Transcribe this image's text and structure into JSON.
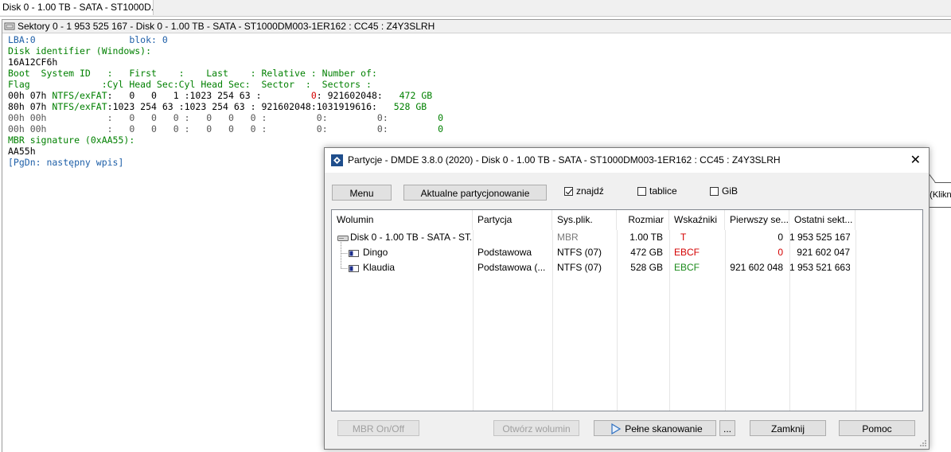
{
  "tab": {
    "label": "Disk 0 - 1.00 TB - SATA - ST1000D..."
  },
  "subwindow": {
    "title": "Sektory 0 - 1 953 525 167 - Disk 0 - 1.00 TB - SATA - ST1000DM003-1ER162 : CC45 : Z4Y3SLRH"
  },
  "hex": {
    "lba_line": "LBA:0                 blok: 0",
    "disk_id_label": "Disk identifier (Windows):",
    "disk_id_value": "16A12CF6h",
    "header1": "Boot  System ID   :   First    :    Last    : Relative : Number of:",
    "header2": "Flag             :Cyl Head Sec:Cyl Head Sec:  Sector  :  Sectors :",
    "rows": [
      {
        "a": "00h 07h ",
        "b": "NTFS/exFAT",
        "c": ":   0   0   1 :1023 254 63 :",
        "d": "         0",
        "e": ": 921602048:",
        "f": "   472 GB"
      },
      {
        "a": "80h 07h ",
        "b": "NTFS/exFAT",
        "c": ":1023 254 63 :1023 254 63 :",
        "d": " 921602048",
        "e": ":1031919616:",
        "f": "   528 GB"
      },
      {
        "a": "00h 00h ",
        "b": "          ",
        "c": ":   0   0   0 :   0   0   0 :",
        "d": "         0",
        "e": ":         0:",
        "f": "         0"
      },
      {
        "a": "00h 00h ",
        "b": "          ",
        "c": ":   0   0   0 :   0   0   0 :",
        "d": "         0",
        "e": ":         0:",
        "f": "         0"
      }
    ],
    "mbr_sig_label": "MBR signature (0xAA55):",
    "mbr_sig_value": "AA55h",
    "pgdn": "[PgDn: następny wpis]"
  },
  "dialog": {
    "title": "Partycje - DMDE 3.8.0 (2020) - Disk 0 - 1.00 TB - SATA - ST1000DM003-1ER162 : CC45 : Z4Y3SLRH",
    "menu_btn": "Menu",
    "actual_btn": "Aktualne partycjonowanie",
    "checkboxes": [
      {
        "label": "znajdź",
        "checked": true
      },
      {
        "label": "tablice",
        "checked": false
      },
      {
        "label": "GiB",
        "checked": false
      }
    ],
    "columns": [
      "Wolumin",
      "Partycja",
      "Sys.plik.",
      "Rozmiar",
      "Wskaźniki",
      "Pierwszy se...",
      "Ostatni sekt..."
    ],
    "rows": [
      {
        "name": "Disk 0 - 1.00 TB - SATA - ST...",
        "partition": "",
        "fs": "MBR",
        "size": "1.00 TB",
        "flags": "T",
        "first": "0",
        "last": "1 953 525 167",
        "icon": "hdd-icon"
      },
      {
        "name": "Dingo",
        "partition": "Podstawowa",
        "fs": "NTFS (07)",
        "size": "472 GB",
        "flags": "EBCF",
        "first": "0",
        "last": "921 602 047",
        "icon": "partition-icon"
      },
      {
        "name": "Klaudia",
        "partition": "Podstawowa (...",
        "fs": "NTFS (07)",
        "size": "528 GB",
        "flags": "EBCF",
        "first": "921 602 048",
        "last": "1 953 521 663",
        "icon": "partition-icon"
      }
    ],
    "bottom_buttons": {
      "mbr": "MBR On/Off",
      "open": "Otwórz wolumin",
      "scan": "Pełne skanowanie",
      "more": "...",
      "close": "Zamknij",
      "help": "Pomoc"
    },
    "tooltip": "? (Klikn"
  },
  "colors": {
    "flag_red": "#d40000",
    "flag_green": "#1a8a1a",
    "hex_text": "#006666"
  }
}
